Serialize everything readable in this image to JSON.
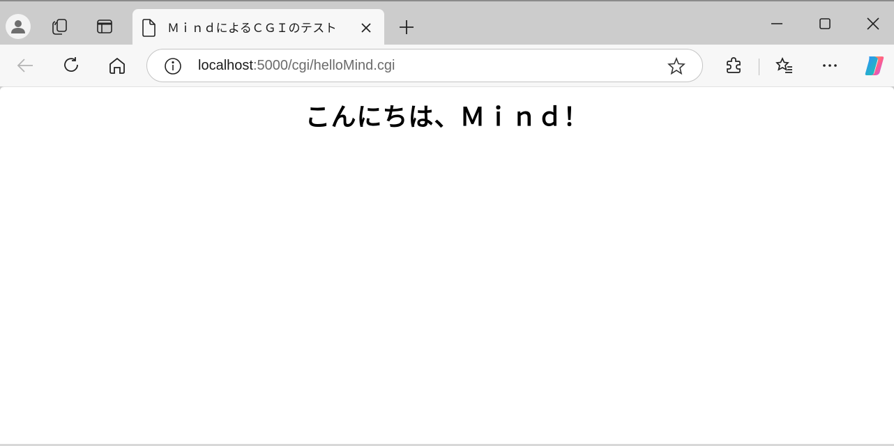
{
  "tab": {
    "title": "ＭｉｎｄによるＣＧＩのテスト"
  },
  "address_bar": {
    "url_host": "localhost",
    "url_path": ":5000/cgi/helloMind.cgi"
  },
  "page": {
    "heading": "こんにちは、Ｍｉｎｄ！"
  },
  "icons": {
    "profile": "profile-avatar-icon",
    "workspaces": "workspaces-icon",
    "tab_actions": "vertical-tabs-icon",
    "tab_page": "document-icon",
    "tab_close": "close-icon",
    "new_tab": "plus-icon",
    "minimize": "minimize-icon",
    "maximize": "maximize-icon",
    "close_window": "close-icon",
    "back": "back-arrow-icon",
    "refresh": "refresh-icon",
    "home": "home-icon",
    "site_info": "info-icon",
    "favorite": "star-icon",
    "extensions": "puzzle-icon",
    "favorites": "favorites-list-icon",
    "more": "ellipsis-icon",
    "copilot": "copilot-icon"
  },
  "colors": {
    "tabstrip_bg": "#cccccc",
    "toolbar_bg": "#f7f7f7",
    "url_path": "#6b6b6b"
  }
}
